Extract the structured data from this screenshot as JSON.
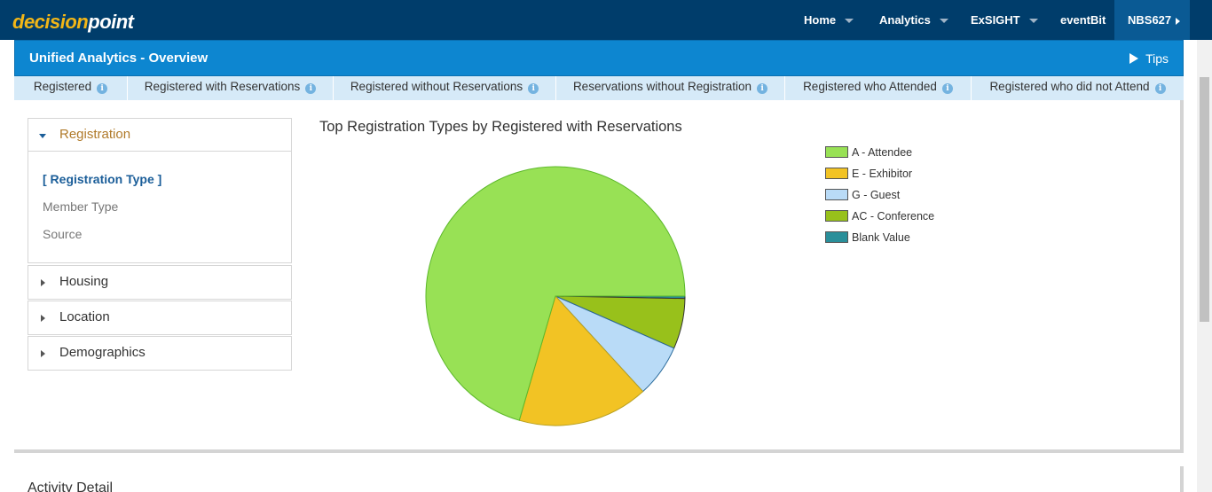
{
  "brand": {
    "part1": "decision",
    "part2": "point"
  },
  "nav": {
    "items": [
      {
        "label": "Home",
        "dropdown": true
      },
      {
        "label": "Analytics",
        "dropdown": true
      },
      {
        "label": "ExSIGHT",
        "dropdown": true
      },
      {
        "label": "eventBit",
        "dropdown": false
      }
    ],
    "user": "NBS627"
  },
  "page": {
    "title": "Unified Analytics - Overview",
    "tips_label": "Tips"
  },
  "metrics": [
    {
      "label": "Registered",
      "info": "i"
    },
    {
      "label": "Registered with Reservations",
      "info": "i"
    },
    {
      "label": "Registered without Reservations",
      "info": "i"
    },
    {
      "label": "Reservations without Registration",
      "info": "i"
    },
    {
      "label": "Registered who Attended",
      "info": "i"
    },
    {
      "label": "Registered who did not Attend",
      "info": "i"
    }
  ],
  "sidebar": {
    "sections": [
      {
        "label": "Registration",
        "open": true,
        "items": [
          {
            "label": "[ Registration Type ]",
            "selected": true
          },
          {
            "label": "Member Type",
            "selected": false
          },
          {
            "label": "Source",
            "selected": false
          }
        ]
      },
      {
        "label": "Housing",
        "open": false
      },
      {
        "label": "Location",
        "open": false
      },
      {
        "label": "Demographics",
        "open": false
      }
    ]
  },
  "chart_data": {
    "type": "pie",
    "title": "Top Registration Types by Registered with Reservations",
    "legend_position": "right",
    "categories": [
      "A - Attendee",
      "E - Exhibitor",
      "G - Guest",
      "AC - Conference",
      "Blank Value"
    ],
    "values": [
      70.5,
      16.3,
      6.6,
      6.3,
      0.3
    ],
    "colors": [
      "#98e155",
      "#f2c324",
      "#b9dbf7",
      "#98c11b",
      "#2a8f9a"
    ]
  },
  "activity": {
    "title": "Activity Detail"
  },
  "colors": {
    "nav_bg": "#003d6b",
    "title_bar": "#0d86d0",
    "metric_bar": "#d6eaf8",
    "brand_accent": "#f2b617"
  }
}
